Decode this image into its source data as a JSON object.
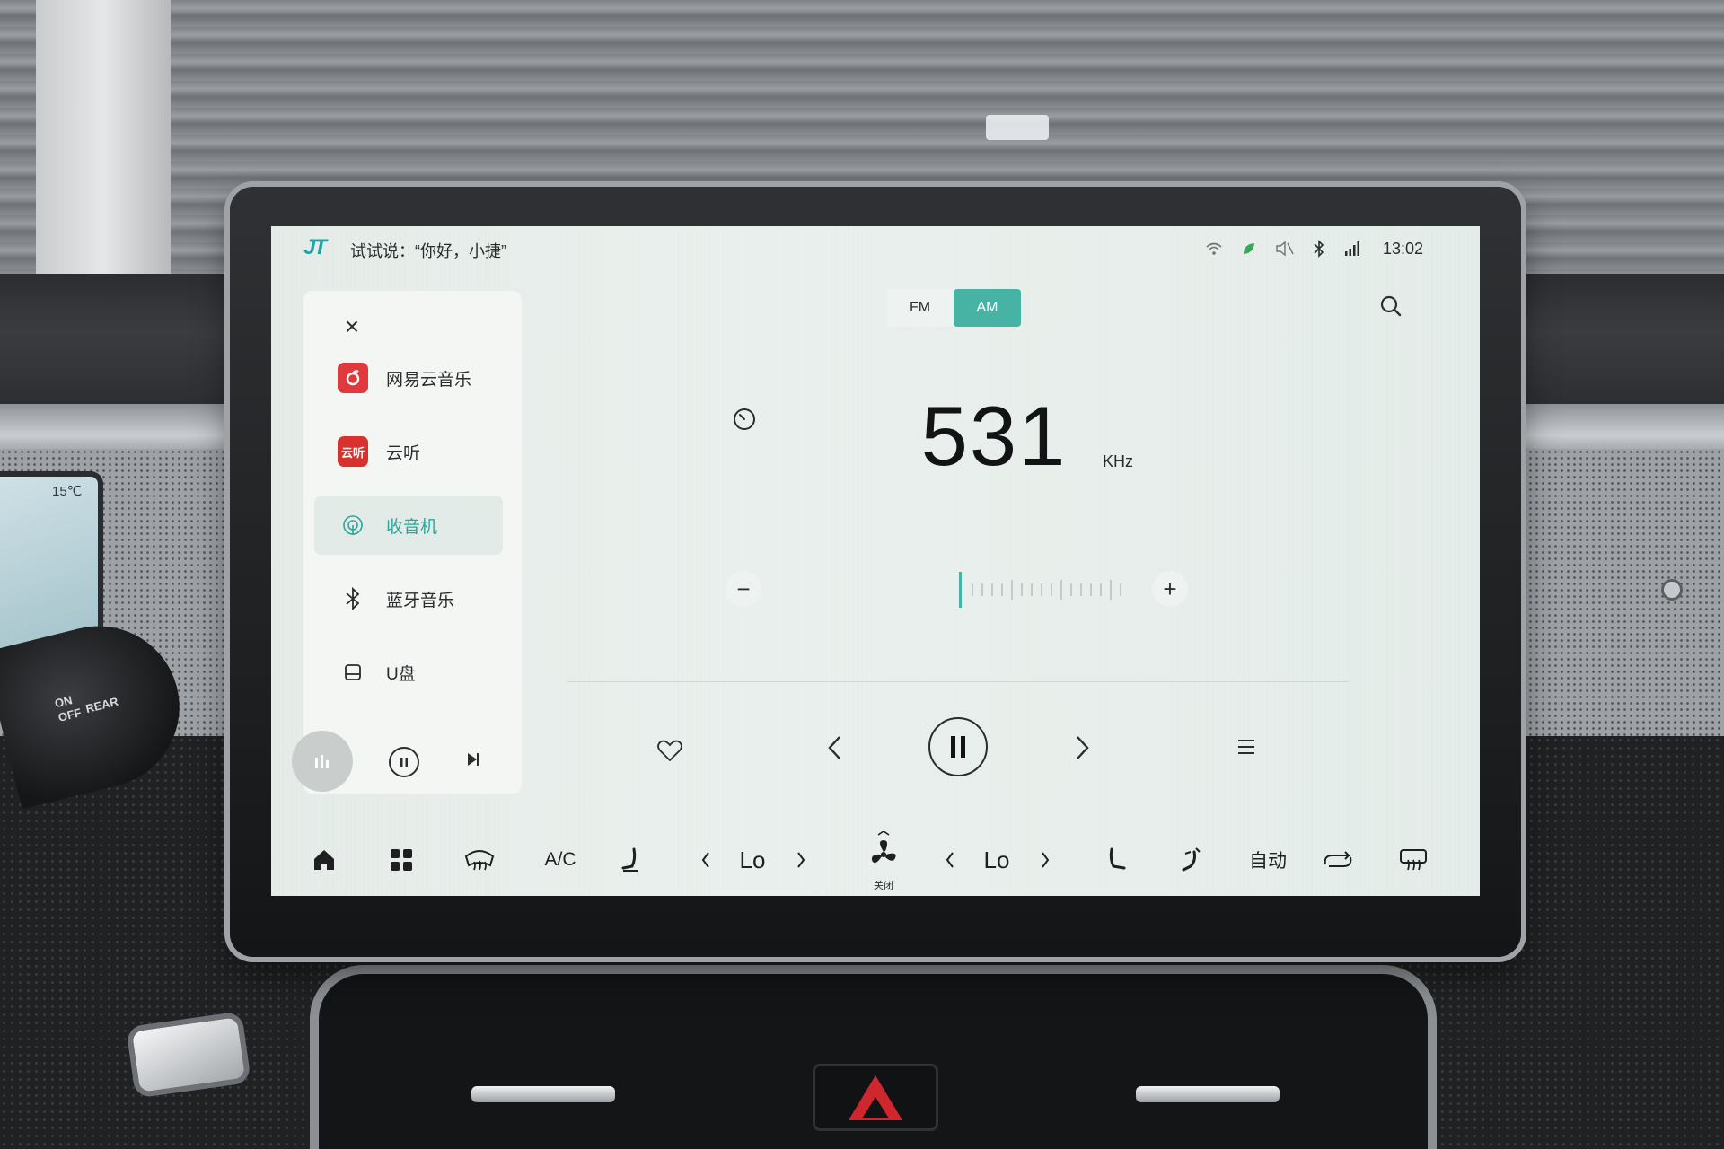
{
  "status_bar": {
    "brand": "JT",
    "voice_hint": "试试说：“你好，小捷”",
    "time": "13:02"
  },
  "sidebar": {
    "sources": [
      {
        "label": "网易云音乐",
        "icon": "netease-cloud-music-icon",
        "color": "#e03a3e",
        "active": false
      },
      {
        "label": "云听",
        "icon": "yunting-icon",
        "color": "#d8322e",
        "active": false
      },
      {
        "label": "收音机",
        "icon": "radio-icon",
        "color": "#2ba69a",
        "active": true
      },
      {
        "label": "蓝牙音乐",
        "icon": "bluetooth-icon",
        "color": "#2a2d2e",
        "active": false
      },
      {
        "label": "U盘",
        "icon": "usb-drive-icon",
        "color": "#2a2d2e",
        "active": false
      }
    ],
    "yunting_glyph": "云听"
  },
  "radio": {
    "bands": [
      "FM",
      "AM"
    ],
    "selected_band": "AM",
    "frequency": "531",
    "unit": "KHz"
  },
  "climate": {
    "ac_label": "A/C",
    "left_temp": "Lo",
    "right_temp": "Lo",
    "fan_status": "关闭",
    "auto_label": "自动"
  },
  "scene": {
    "cluster_temp": "15℃",
    "stalk_on": "ON",
    "stalk_off": "OFF",
    "stalk_rear": "REAR"
  },
  "colors": {
    "accent": "#47b3a5",
    "accent_text": "#2ba69a"
  }
}
